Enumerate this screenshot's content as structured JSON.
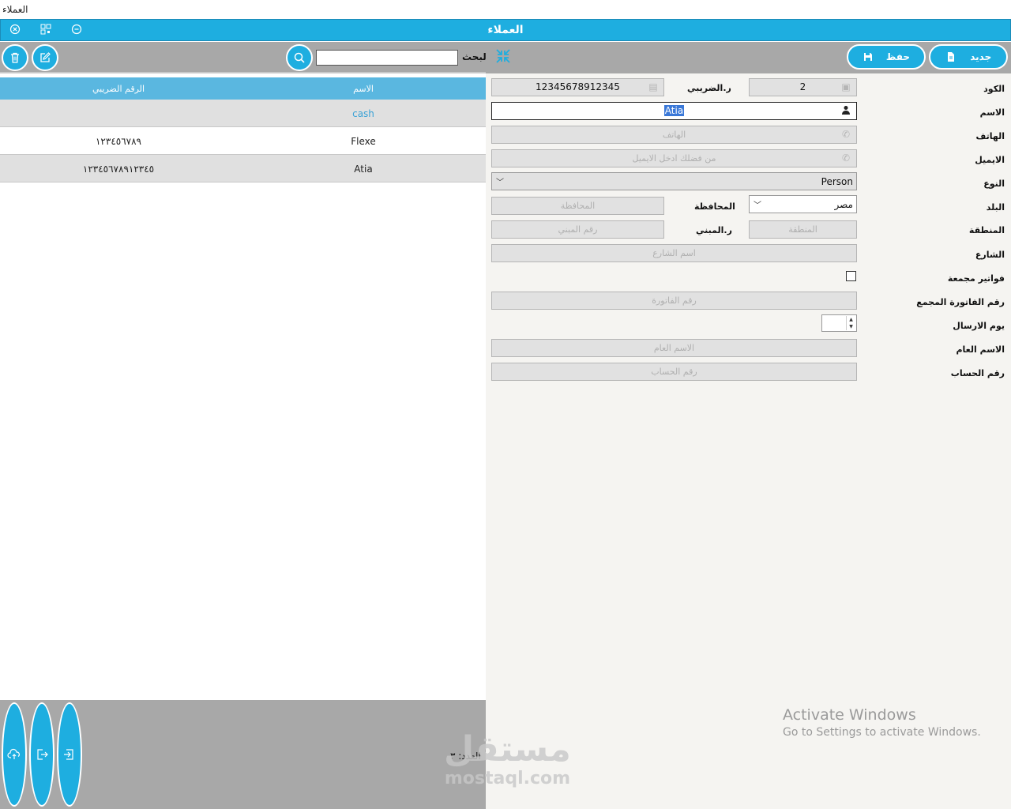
{
  "window": {
    "caption": "العملاء",
    "title": "العملاء"
  },
  "titlebar_icons": [
    "close-circle-icon",
    "qr-icon",
    "minimize-circle-icon"
  ],
  "left_toolbar": {
    "search_label": "البحث",
    "search_value": ""
  },
  "grid": {
    "columns": {
      "name": "الاسم",
      "tax": "الرقم الضريبي"
    },
    "rows": [
      {
        "name": "cash",
        "tax": ""
      },
      {
        "name": "Flexe",
        "tax": "١٢٣٤٥٦٧٨٩"
      },
      {
        "name": "Atia",
        "tax": "١٢٣٤٥٦٧٨٩١٢٣٤٥"
      }
    ]
  },
  "footer": {
    "count_label": "العدد: ٣"
  },
  "right_toolbar": {
    "new_label": "جديد",
    "save_label": "حفظ"
  },
  "form": {
    "labels": {
      "code": "الكود",
      "name": "الاسم",
      "phone": "الهاتف",
      "mobile": "الايميل",
      "type": "النوع",
      "country": "البلد",
      "region": "المنطقة",
      "street": "الشارع",
      "grouped_invoices": "فواتير مجمعة",
      "grouped_invoice_no": "رقم الفاتورة المجمع",
      "send_day": "يوم الارسال",
      "general_name": "الاسم العام",
      "account_no": "رقم الحساب",
      "tax_no": "ر.الضريبي",
      "governorate": "المحافظة",
      "building_no": "ر.المبني"
    },
    "values": {
      "code": "2",
      "tax_no": "12345678912345",
      "name": "Atia",
      "type": "Person",
      "country": "مصر",
      "send_day": ""
    },
    "placeholders": {
      "phone": "الهاتف",
      "email": "من فضلك ادخل الايميل",
      "governorate": "المحافظة",
      "region": "المنطقة",
      "building_no": "رقم المبني",
      "street": "اسم الشارع",
      "invoice_no": "رقم الفاتورة",
      "general_name": "الاسم العام",
      "account_no": "رقم الحساب"
    }
  },
  "watermark": {
    "line1": "Activate Windows",
    "line2": "Go to Settings to activate Windows."
  },
  "overlay_logo": {
    "arabic": "مستقل",
    "latin": "mostaql.com"
  },
  "colors": {
    "accent": "#1eaee0",
    "header_row": "#5ab7e0",
    "toolbar": "#a8a8a8",
    "form_bg": "#f5f4f1"
  }
}
